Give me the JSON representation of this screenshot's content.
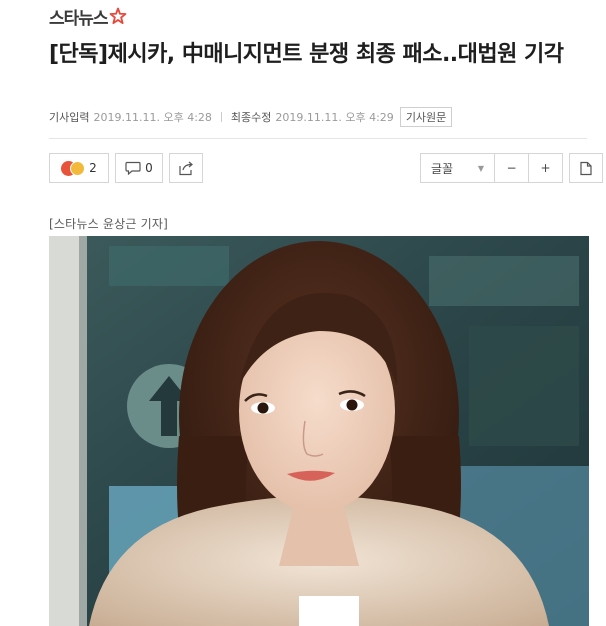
{
  "header": {
    "logo_text": "스타뉴스"
  },
  "article": {
    "headline": "[단독]제시카, 中매니지먼트 분쟁 최종 패소..대법원 기각",
    "input_label": "기사입력",
    "input_date": "2019.11.11. 오후 4:28",
    "updated_label": "최종수정",
    "updated_date": "2019.11.11. 오후 4:29",
    "original_button": "기사원문",
    "reporter": "[스타뉴스 윤상근 기자]"
  },
  "toolbar": {
    "reaction_count": "2",
    "comment_count": "0",
    "font_label": "글꼴",
    "minus": "−",
    "plus": "+"
  },
  "colors": {
    "logo_star": "#e8483a",
    "photo_bg": "#2f4b4e"
  },
  "icons": [
    "star-logo-icon",
    "angry-emoji-icon",
    "smile-emoji-icon",
    "comment-icon",
    "share-icon",
    "caret-down-icon",
    "print-icon"
  ]
}
